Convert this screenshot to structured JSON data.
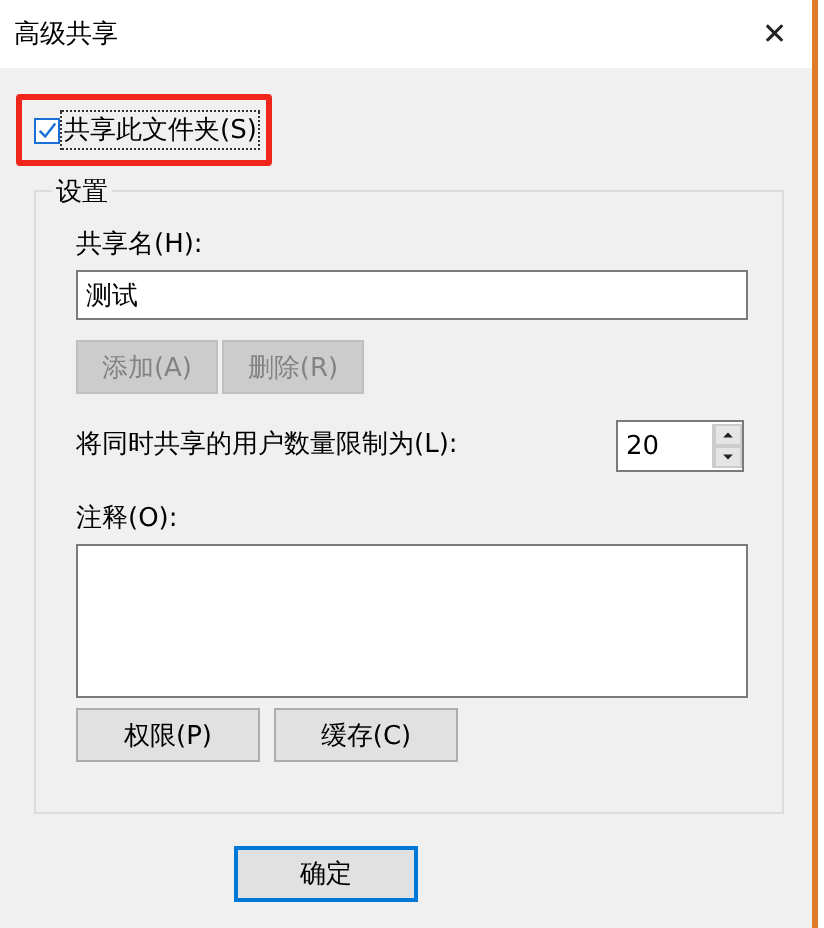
{
  "window": {
    "title": "高级共享",
    "close": "✕"
  },
  "share_checkbox": {
    "label": "共享此文件夹(S)",
    "checked": true,
    "highlighted": true
  },
  "settings": {
    "title": "设置",
    "share_name": {
      "label": "共享名(H):",
      "value": "测试"
    },
    "name_buttons": [
      {
        "label": "添加(A)",
        "disabled": true
      },
      {
        "label": "删除(R)",
        "disabled": true
      }
    ],
    "user_limit": {
      "label": "将同时共享的用户数量限制为(L):",
      "value": "20"
    },
    "comment": {
      "label": "注释(O):"
    },
    "buttons": [
      {
        "label": "权限(P)"
      },
      {
        "label": "缓存(C)"
      }
    ]
  },
  "footer_buttons": [
    {
      "label": "确定",
      "default": true
    }
  ]
}
